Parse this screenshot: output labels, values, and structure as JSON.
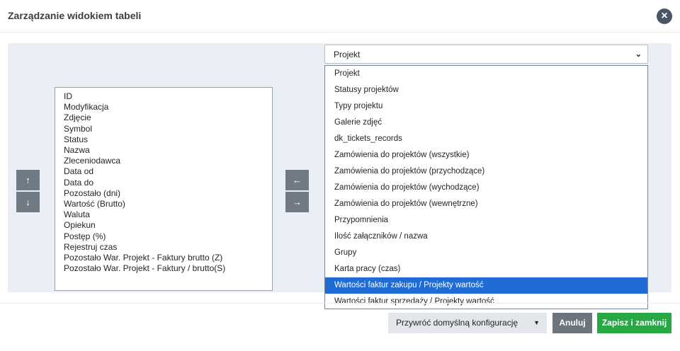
{
  "header": {
    "title": "Zarządzanie widokiem tabeli",
    "close_icon": "×"
  },
  "column_list": {
    "items": [
      {
        "label": "ID"
      },
      {
        "label": "Modyfikacja"
      },
      {
        "label": "Zdjęcie"
      },
      {
        "label": "Symbol"
      },
      {
        "label": "Status"
      },
      {
        "label": "Nazwa"
      },
      {
        "label": "Zleceniodawca"
      },
      {
        "label": "Data od"
      },
      {
        "label": "Data do"
      },
      {
        "label": "Pozostało (dni)"
      },
      {
        "label": "Wartość (Brutto)"
      },
      {
        "label": "Waluta"
      },
      {
        "label": "Opiekun"
      },
      {
        "label": "Postęp (%)"
      },
      {
        "label": "Rejestruj czas"
      },
      {
        "label": "Pozostało War. Projekt - Faktury brutto (Z)"
      },
      {
        "label": "Pozostało War. Projekt - Faktury / brutto(S)"
      }
    ]
  },
  "order_buttons": {
    "up_icon": "↑",
    "down_icon": "↓"
  },
  "transfer_buttons": {
    "left_icon": "←",
    "right_icon": "→"
  },
  "source_select": {
    "value": "Projekt",
    "chevron": "⌄",
    "options": [
      {
        "label": "Projekt"
      },
      {
        "label": "Statusy projektów"
      },
      {
        "label": "Typy projektu"
      },
      {
        "label": "Galerie zdjęć"
      },
      {
        "label": "dk_tickets_records"
      },
      {
        "label": "Zamówienia do projektów (wszystkie)"
      },
      {
        "label": "Zamówienia do projektów (przychodzące)"
      },
      {
        "label": "Zamówienia do projektów (wychodzące)"
      },
      {
        "label": "Zamówienia do projektów (wewnętrzne)"
      },
      {
        "label": "Przypomnienia"
      },
      {
        "label": "Ilość załączników / nazwa"
      },
      {
        "label": "Grupy"
      },
      {
        "label": "Karta pracy (czas)"
      },
      {
        "label": "Wartości faktur zakupu / Projekty wartość"
      },
      {
        "label": "Wartości faktur sprzedaży / Projekty wartość"
      }
    ],
    "highlighted_option": "Wartości faktur zakupu / Projekty wartość"
  },
  "footer": {
    "reset_label": "Przywróć domyślną konfigurację",
    "reset_caret": "▼",
    "cancel_label": "Anuluj",
    "save_label": "Zapisz i zamknij"
  },
  "colors": {
    "accent_highlight": "#1f6cd6",
    "save_button": "#28a745",
    "cancel_button": "#6c757d",
    "panel_background": "#e9eff4"
  }
}
